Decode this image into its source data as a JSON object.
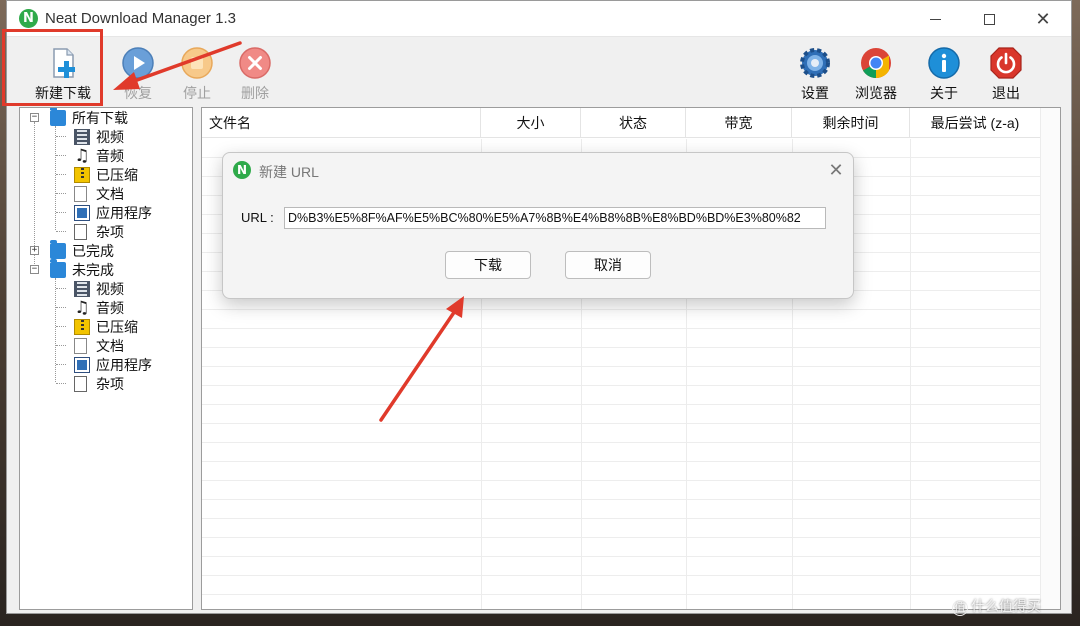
{
  "window": {
    "title": "Neat Download Manager 1.3",
    "app_icon_letter": "N"
  },
  "window_controls": {
    "minimize": "–",
    "maximize": "□",
    "close": "✕"
  },
  "toolbar": {
    "new_download": "新建下载",
    "resume": "恢复",
    "stop": "停止",
    "delete": "删除",
    "settings": "设置",
    "browser": "浏览器",
    "about": "关于",
    "exit": "退出"
  },
  "tree": {
    "expander_plus": "+",
    "expander_minus": "−",
    "all_downloads": {
      "label": "所有下载",
      "children": [
        "视频",
        "音频",
        "已压缩",
        "文档",
        "应用程序",
        "杂项"
      ]
    },
    "completed": {
      "label": "已完成"
    },
    "incomplete": {
      "label": "未完成",
      "children": [
        "视频",
        "音频",
        "已压缩",
        "文档",
        "应用程序",
        "杂项"
      ]
    },
    "music_glyph": "♫"
  },
  "list": {
    "columns": [
      "文件名",
      "大小",
      "状态",
      "带宽",
      "剩余时间",
      "最后尝试 (z-a)"
    ]
  },
  "dialog": {
    "icon_letter": "N",
    "title": "新建 URL",
    "close": "✕",
    "url_label": "URL :",
    "url_value": "D%B3%E5%8F%AF%E5%BC%80%E5%A7%8B%E4%B8%8B%E8%BD%BD%E3%80%82",
    "download_button": "下载",
    "cancel_button": "取消"
  },
  "watermark": {
    "icon": "值",
    "text": "什么值得买"
  },
  "colors": {
    "annotation_red": "#e03a2b",
    "app_green": "#2faa4a",
    "folder_blue": "#2b87d8"
  }
}
